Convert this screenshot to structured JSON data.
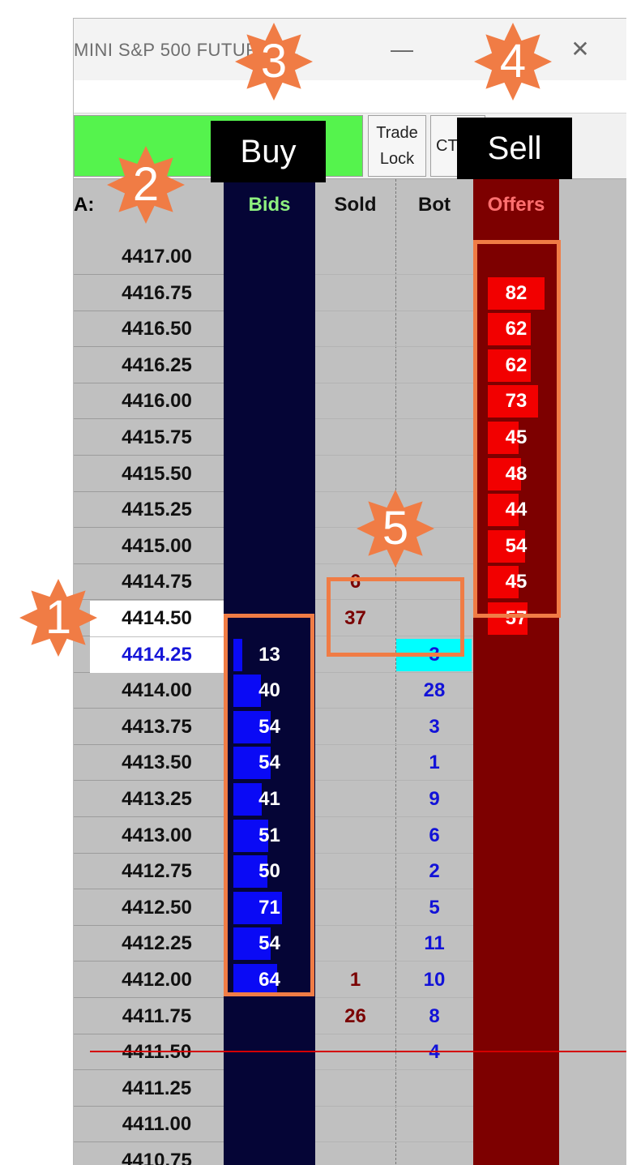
{
  "window": {
    "title": "MINI S&P 500 FUTURES...",
    "minimize_glyph": "—",
    "close_glyph": "✕"
  },
  "toolbar": {
    "trade_lock_label": "Trade\nLock",
    "ct_label": "CT"
  },
  "ladder": {
    "price_header": "A:",
    "headers": {
      "bids": "Bids",
      "sold": "Sold",
      "bot": "Bot",
      "offers": "Offers"
    },
    "header_colors": {
      "bids": "#8ef07f",
      "sold": "#111111",
      "bot": "#111111",
      "offers": "#ff7070"
    },
    "rows": [
      {
        "price": "4417.00",
        "bid": "",
        "sold": "",
        "bot": "",
        "offer": ""
      },
      {
        "price": "4416.75",
        "bid": "",
        "sold": "",
        "bot": "",
        "offer": "82"
      },
      {
        "price": "4416.50",
        "bid": "",
        "sold": "",
        "bot": "",
        "offer": "62"
      },
      {
        "price": "4416.25",
        "bid": "",
        "sold": "",
        "bot": "",
        "offer": "62"
      },
      {
        "price": "4416.00",
        "bid": "",
        "sold": "",
        "bot": "",
        "offer": "73"
      },
      {
        "price": "4415.75",
        "bid": "",
        "sold": "",
        "bot": "",
        "offer": "45"
      },
      {
        "price": "4415.50",
        "bid": "",
        "sold": "",
        "bot": "",
        "offer": "48"
      },
      {
        "price": "4415.25",
        "bid": "",
        "sold": "",
        "bot": "",
        "offer": "44"
      },
      {
        "price": "4415.00",
        "bid": "",
        "sold": "",
        "bot": "",
        "offer": "54"
      },
      {
        "price": "4414.75",
        "bid": "",
        "sold": "6",
        "bot": "",
        "offer": "45"
      },
      {
        "price": "4414.50",
        "bid": "",
        "sold": "37",
        "bot": "",
        "offer": "57"
      },
      {
        "price": "4414.25",
        "bid": "13",
        "sold": "",
        "bot": "3",
        "offer": ""
      },
      {
        "price": "4414.00",
        "bid": "40",
        "sold": "",
        "bot": "28",
        "offer": ""
      },
      {
        "price": "4413.75",
        "bid": "54",
        "sold": "",
        "bot": "3",
        "offer": ""
      },
      {
        "price": "4413.50",
        "bid": "54",
        "sold": "",
        "bot": "1",
        "offer": ""
      },
      {
        "price": "4413.25",
        "bid": "41",
        "sold": "",
        "bot": "9",
        "offer": ""
      },
      {
        "price": "4413.00",
        "bid": "51",
        "sold": "",
        "bot": "6",
        "offer": ""
      },
      {
        "price": "4412.75",
        "bid": "50",
        "sold": "",
        "bot": "2",
        "offer": ""
      },
      {
        "price": "4412.50",
        "bid": "71",
        "sold": "",
        "bot": "5",
        "offer": ""
      },
      {
        "price": "4412.25",
        "bid": "54",
        "sold": "",
        "bot": "11",
        "offer": ""
      },
      {
        "price": "4412.00",
        "bid": "64",
        "sold": "1",
        "bot": "10",
        "offer": ""
      },
      {
        "price": "4411.75",
        "bid": "",
        "sold": "26",
        "bot": "8",
        "offer": ""
      },
      {
        "price": "4411.50",
        "bid": "",
        "sold": "",
        "bot": "4",
        "offer": ""
      },
      {
        "price": "4411.25",
        "bid": "",
        "sold": "",
        "bot": "",
        "offer": ""
      },
      {
        "price": "4411.00",
        "bid": "",
        "sold": "",
        "bot": "",
        "offer": ""
      },
      {
        "price": "4410.75",
        "bid": "",
        "sold": "",
        "bot": "",
        "offer": ""
      }
    ],
    "last_trade_price": "4414.50",
    "inside_bid_price": "4414.25"
  },
  "annotations": {
    "buy_label": "Buy",
    "sell_label": "Sell",
    "markers": [
      "1",
      "2",
      "3",
      "4",
      "5"
    ],
    "accent_color": "#f07c45"
  }
}
